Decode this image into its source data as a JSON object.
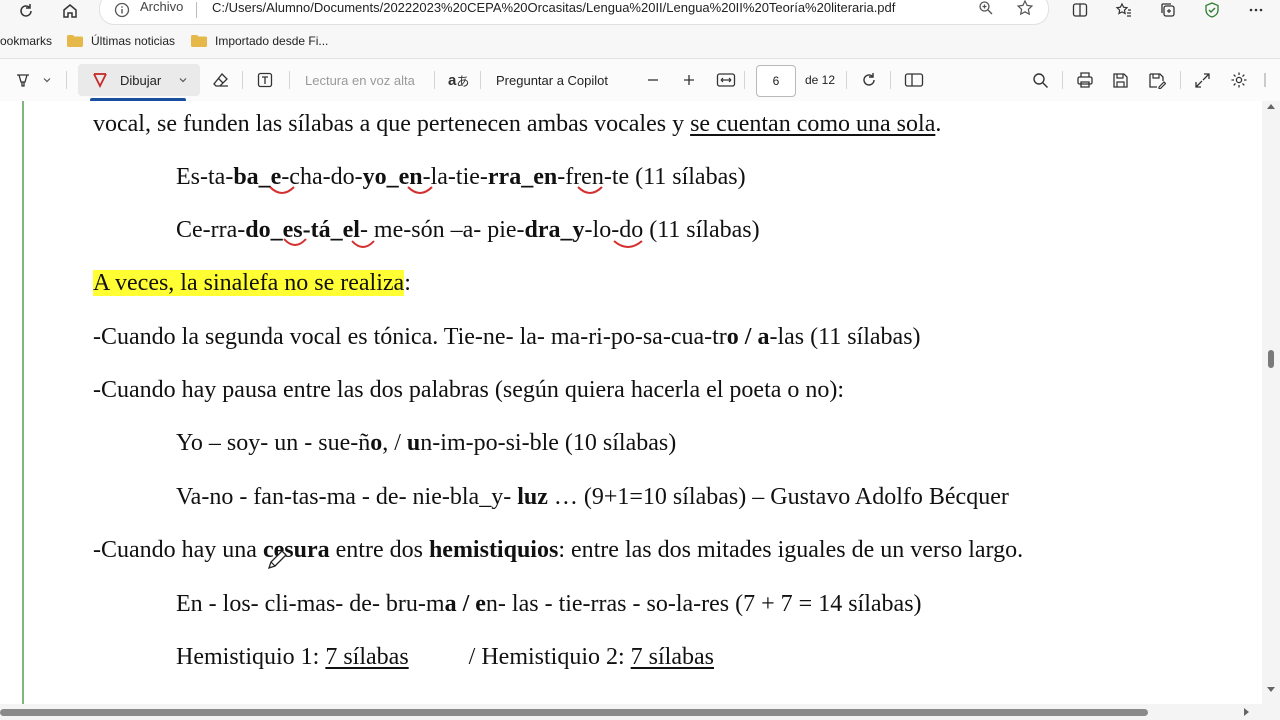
{
  "browser": {
    "archivo_label": "Archivo",
    "url": "C:/Users/Alumno/Documents/20222023%20CEPA%20Orcasitas/Lengua%20II/Lengua%20II%20Teoría%20literaria.pdf"
  },
  "bookmarks": [
    {
      "label": "ookmarks"
    },
    {
      "label": "Últimas noticias"
    },
    {
      "label": "Importado desde Fi..."
    }
  ],
  "pdf_toolbar": {
    "draw_label": "Dibujar",
    "read_aloud_label": "Lectura en voz alta",
    "copilot_label": "Preguntar a Copilot",
    "page_current": "6",
    "page_total_label": "de 12"
  },
  "document": {
    "line1_a": "vocal, se funden las sílabas a que pertenecen ambas vocales y ",
    "line1_b": "se cuentan como una sola",
    "line1_c": ".",
    "ex1": [
      {
        "t": "Es-ta-",
        "b": false
      },
      {
        "t": "ba_e",
        "b": true
      },
      {
        "t": "-cha-do-",
        "b": false
      },
      {
        "t": "yo_en",
        "b": true
      },
      {
        "t": "-la-tie-",
        "b": false
      },
      {
        "t": "rra_en",
        "b": true
      },
      {
        "t": "-fren-te (11 sílabas)",
        "b": false
      }
    ],
    "ex2": [
      {
        "t": "Ce-rra-",
        "b": false
      },
      {
        "t": "do_es-tá_el",
        "b": true
      },
      {
        "t": "- me-són –a- pie-",
        "b": false
      },
      {
        "t": "dra_y",
        "b": true
      },
      {
        "t": "-lo-do (11 sílabas)",
        "b": false
      }
    ],
    "highlight": "A veces, la sinalefa no se realiza",
    "colon": ":",
    "rule1": [
      {
        "t": "-Cuando la segunda vocal es tónica. Tie-ne- la- ma-ri-po-sa-cua-tr",
        "b": false
      },
      {
        "t": "o / a",
        "b": true
      },
      {
        "t": "-las (11 sílabas)",
        "b": false
      }
    ],
    "rule2": "-Cuando hay pausa entre las dos palabras (según quiera hacerla el poeta o no):",
    "ex3": [
      {
        "t": "Yo – soy- un - sue-ñ",
        "b": false
      },
      {
        "t": "o",
        "b": true
      },
      {
        "t": ", / ",
        "b": false
      },
      {
        "t": "u",
        "b": true
      },
      {
        "t": "n-im-po-si-ble (10 sílabas)",
        "b": false
      }
    ],
    "ex4": [
      {
        "t": "Va-no - fan-tas-ma - de- nie-bla_y- ",
        "b": false
      },
      {
        "t": "luz",
        "b": true
      },
      {
        "t": " … (9+1=10 sílabas) – Gustavo Adolfo Bécquer",
        "b": false
      }
    ],
    "rule3": [
      {
        "t": "-Cuando hay una ",
        "b": false
      },
      {
        "t": "cesura",
        "b": true
      },
      {
        "t": " entre dos ",
        "b": false
      },
      {
        "t": "hemistiquios",
        "b": true
      },
      {
        "t": ": entre las dos mitades iguales de un verso largo.",
        "b": false
      }
    ],
    "ex5": [
      {
        "t": "En - los- cli-mas- de- bru-m",
        "b": false
      },
      {
        "t": "a / e",
        "b": true
      },
      {
        "t": "n- las - tie-rras - so-la-res (7 + 7 = 14 sílabas)",
        "b": false
      }
    ],
    "hemi1_label": "Hemistiquio 1: ",
    "hemi1_value": "7 sílabas",
    "hemi2_label": "/ Hemistiquio 2: ",
    "hemi2_value": "7 sílabas"
  }
}
